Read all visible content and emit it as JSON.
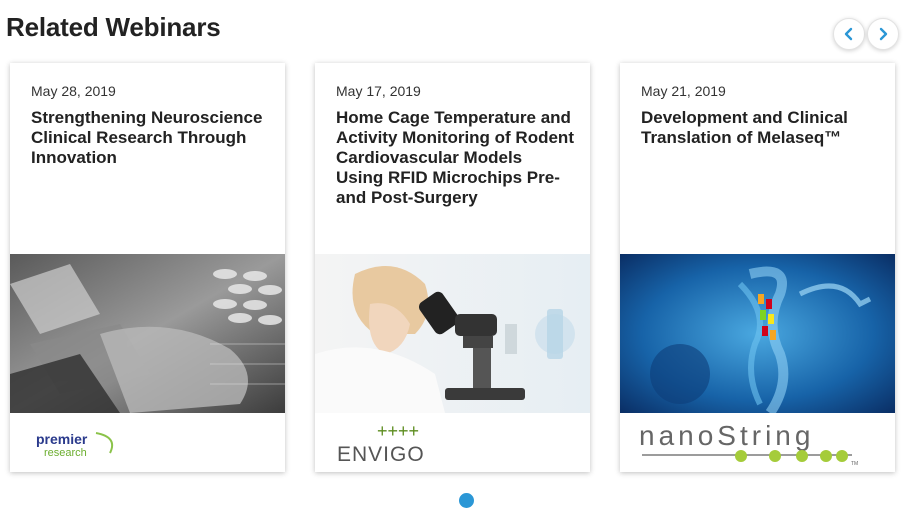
{
  "section": {
    "title": "Related Webinars"
  },
  "carousel": {
    "prev_icon": "chevron-left-icon",
    "next_icon": "chevron-right-icon",
    "accent_color": "#2b97d6"
  },
  "webinars": [
    {
      "date": "May 28, 2019",
      "title": "Strengthening Neuroscience Clinical Research Through Innovation",
      "sponsor_logo": {
        "line1": "premier",
        "line2": "research"
      }
    },
    {
      "date": "May 17, 2019",
      "title": "Home Cage Temperature and Activity Monitoring of Rodent Cardiovascular Models Using RFID Microchips Pre- and Post-Surgery",
      "sponsor_logo": {
        "mark": "++++",
        "name": "ENVIGO"
      }
    },
    {
      "date": "May 21, 2019",
      "title": "Development and Clinical Translation of Melaseq™",
      "sponsor_logo": {
        "name": "nanoString",
        "tm": "TM"
      }
    }
  ]
}
